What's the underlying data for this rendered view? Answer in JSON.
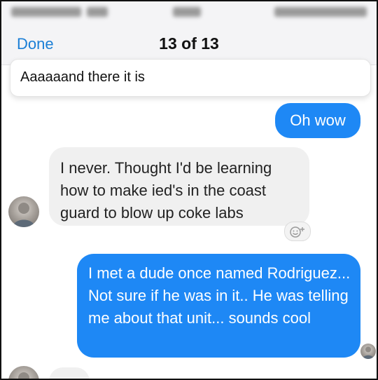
{
  "nav": {
    "done_label": "Done",
    "title": "13 of 13"
  },
  "result_snippet": {
    "text": "Aaaaaand there it is"
  },
  "messages": [
    {
      "direction": "outgoing",
      "text": "Oh wow"
    },
    {
      "direction": "incoming",
      "text": "I never. Thought I'd be learning how to make ied's in the coast guard to blow up coke labs"
    },
    {
      "direction": "outgoing",
      "text": "I met a dude once named Rodriguez... Not sure if he was in it.. He was telling me about that unit... sounds cool"
    }
  ],
  "reaction_icon": "smiley-add-icon",
  "colors": {
    "accent": "#1b7fd6",
    "outgoing_bubble": "#1e88f5",
    "incoming_bubble": "#f0f0f0"
  }
}
